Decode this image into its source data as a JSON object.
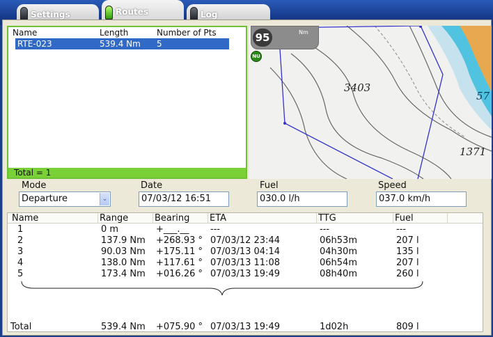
{
  "tabs": [
    {
      "label": "Settings",
      "active": false
    },
    {
      "label": "Routes",
      "active": true
    },
    {
      "label": "Log",
      "active": false
    }
  ],
  "route_list": {
    "headers": [
      "Name",
      "Length",
      "Number of Pts"
    ],
    "rows": [
      [
        "RTE-023",
        "539.4 Nm",
        "5"
      ]
    ],
    "total": "Total = 1"
  },
  "chart": {
    "range": "95",
    "range_unit": "Nm",
    "north_badge": "NU",
    "depth_labels": [
      "3403",
      "1371",
      "57"
    ]
  },
  "fields": {
    "mode": {
      "label": "Mode",
      "value": "Departure"
    },
    "date": {
      "label": "Date",
      "value": "07/03/12 16:51"
    },
    "fuel": {
      "label": "Fuel",
      "value": "030.0 l/h"
    },
    "speed": {
      "label": "Speed",
      "value": "037.0 km/h"
    }
  },
  "waypoints": {
    "headers": [
      "Name",
      "Range",
      "Bearing",
      "ETA",
      "TTG",
      "Fuel"
    ],
    "rows": [
      [
        "1",
        "0 m",
        "+___.__",
        "---",
        "---",
        "---"
      ],
      [
        "2",
        "137.9 Nm",
        "+268.93 °",
        "07/03/12 23:44",
        "06h53m",
        "207 l"
      ],
      [
        "3",
        "90.03 Nm",
        "+175.11 °",
        "07/03/13 04:14",
        "04h30m",
        "135 l"
      ],
      [
        "4",
        "138.0 Nm",
        "+117.61 °",
        "07/03/13 11:08",
        "06h54m",
        "207 l"
      ],
      [
        "5",
        "173.4 Nm",
        "+016.26 °",
        "07/03/13 19:49",
        "08h40m",
        "260 l"
      ]
    ],
    "total": [
      "Total",
      "539.4 Nm",
      "+075.90 °",
      "07/03/13 19:49",
      "1d02h",
      "809 l"
    ]
  },
  "colors": {
    "accent_green": "#6ec132",
    "selection_blue": "#3169c6",
    "route_line": "#3333cc",
    "land_orange": "#e8a850",
    "shallow_cyan": "#4fc3df"
  }
}
